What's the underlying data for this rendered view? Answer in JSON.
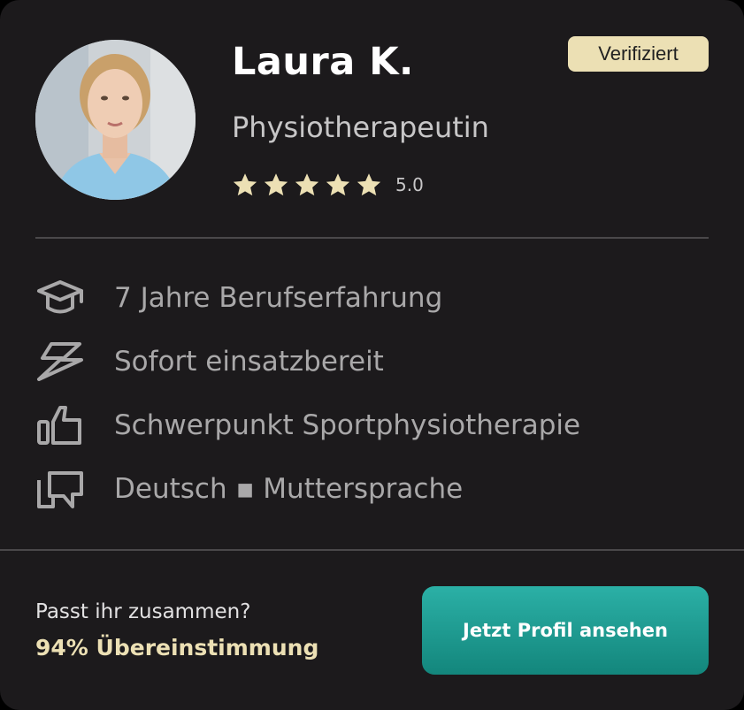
{
  "profile": {
    "name": "Laura K.",
    "role": "Physiotherapeutin",
    "badge": "Verifiziert",
    "rating": "5.0",
    "stars": 5
  },
  "features": [
    {
      "icon": "graduation-cap-icon",
      "text": "7 Jahre Berufserfahrung"
    },
    {
      "icon": "lightning-icon",
      "text": "Sofort einsatzbereit"
    },
    {
      "icon": "thumbs-up-icon",
      "text": "Schwerpunkt Sportphysiotherapie"
    },
    {
      "icon": "chat-bubbles-icon",
      "text": "Deutsch ▪ Muttersprache"
    }
  ],
  "footer": {
    "question": "Passt ihr zusammen?",
    "match": "94% Übereinstimmung",
    "cta": "Jetzt Profil ansehen"
  },
  "colors": {
    "card_background": "#1c1a1c",
    "accent_gold": "#ece0b4",
    "cta_teal": "#1a9d93",
    "muted_text": "#a9a8a9"
  }
}
